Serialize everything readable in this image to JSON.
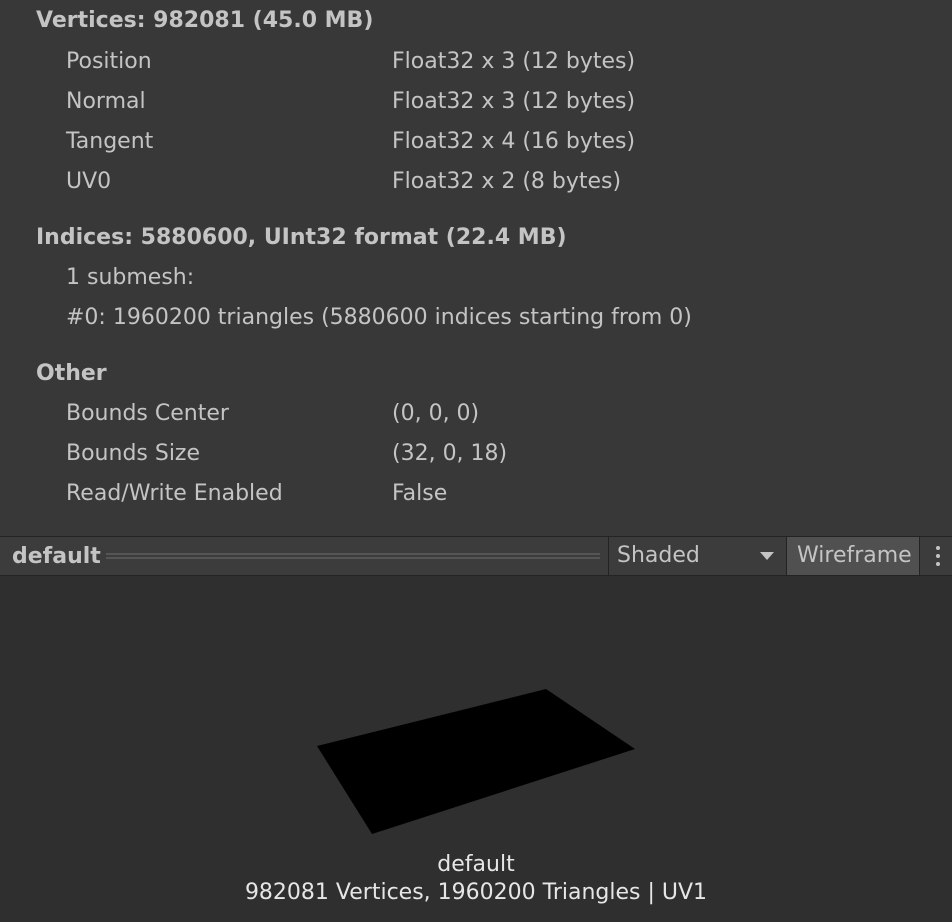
{
  "vertices": {
    "title": "Vertices: 982081 (45.0 MB)",
    "attributes": [
      {
        "name": "Position",
        "format": "Float32 x 3 (12 bytes)"
      },
      {
        "name": "Normal",
        "format": "Float32 x 3 (12 bytes)"
      },
      {
        "name": "Tangent",
        "format": "Float32 x 4 (16 bytes)"
      },
      {
        "name": "UV0",
        "format": "Float32 x 2 (8 bytes)"
      }
    ]
  },
  "indices": {
    "title": "Indices: 5880600, UInt32 format (22.4 MB)",
    "submesh_count": "1 submesh:",
    "submesh_0": "#0: 1960200 triangles (5880600 indices starting from 0)"
  },
  "other": {
    "title": "Other",
    "rows": [
      {
        "name": "Bounds Center",
        "value": "(0, 0, 0)"
      },
      {
        "name": "Bounds Size",
        "value": "(32, 0, 18)"
      },
      {
        "name": "Read/Write Enabled",
        "value": "False"
      }
    ]
  },
  "preview_toolbar": {
    "title": "default",
    "shading_mode": "Shaded",
    "wireframe_label": "Wireframe",
    "menu_icon": "kebab-menu-icon"
  },
  "preview": {
    "mesh_name": "default",
    "mesh_info": "982081 Vertices, 1960200 Triangles | UV1"
  },
  "colors": {
    "background": "#383838",
    "preview_background": "#2f2f2f",
    "text": "#c4c4c4",
    "mesh": "#000000"
  }
}
